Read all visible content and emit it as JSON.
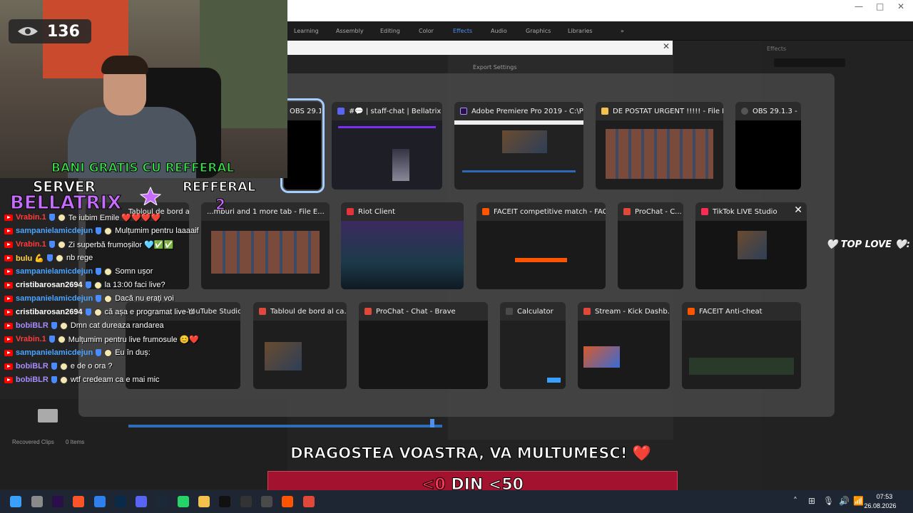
{
  "premiere": {
    "workspace_tabs": [
      "Learning",
      "Assembly",
      "Editing",
      "Color",
      "Effects",
      "Audio",
      "Graphics",
      "Libraries"
    ],
    "overflow": "»",
    "effects_panel": "Effects",
    "export_settings": "Export Settings",
    "recovered_clips": "Recovered Clips",
    "items_count": "0 Items"
  },
  "switcher": {
    "windows": [
      {
        "title": "OBS 29.1.3 -",
        "icon_color": "#555555"
      },
      {
        "title": "#💬 | staff-chat | Bellatrix R...",
        "icon_color": "#5865F2"
      },
      {
        "title": "Adobe Premiere Pro 2019 - C:\\PR...",
        "icon_color": "#9999ff"
      },
      {
        "title": "DE POSTAT URGENT !!!!! - File Ex...",
        "icon_color": "#f2c14e"
      },
      {
        "title": "OBS 29.1.3 -",
        "icon_color": "#555555"
      },
      {
        "title": "Tabloul de bord al...",
        "icon_color": "#e0483a"
      },
      {
        "title": "...mburi and 1 more tab - File E...",
        "icon_color": "#f2c14e"
      },
      {
        "title": "Riot Client",
        "icon_color": "#e2343a"
      },
      {
        "title": "FACEIT competitive match - FACE...",
        "icon_color": "#ff5500"
      },
      {
        "title": "ProChat - C...",
        "icon_color": "#e0483a"
      },
      {
        "title": "TikTok LIVE Studio",
        "icon_color": "#fe2c55"
      },
      {
        "title": "... - YouTube Studio...",
        "icon_color": "#ff0000"
      },
      {
        "title": "Tabloul de bord al ca...",
        "icon_color": "#e0483a"
      },
      {
        "title": "ProChat - Chat - Brave",
        "icon_color": "#e0483a"
      },
      {
        "title": "Calculator",
        "icon_color": "#4a4a4a"
      },
      {
        "title": "Stream - Kick Dashb...",
        "icon_color": "#e0483a"
      },
      {
        "title": "FACEIT Anti-cheat",
        "icon_color": "#ff5500"
      }
    ],
    "close_glyph": "✕"
  },
  "stream": {
    "viewers": "136",
    "promo": {
      "bani": "BANI GRATIS CU REFFERAL",
      "server": "SERVER",
      "bellatrix": "BELLATRIX",
      "refferal": "REFFERAL",
      "two": "2"
    },
    "top_love": "🤍 TOP LOVE 🤍:",
    "banner": "DRAGOSTEA VOASTRA, VA MULTUMESC! ❤️",
    "goal_lead": "<0",
    "goal_rest": " DIN <50"
  },
  "chat": [
    {
      "user": "Vrabin.1",
      "color": "#ff3b3b",
      "msg": "Te iubim Emile ❤️❤️❤️❤️"
    },
    {
      "user": "sampanielamicdejun",
      "color": "#4aa3ff",
      "msg": "Mulțumim pentru laaaaif"
    },
    {
      "user": "Vrabin.1",
      "color": "#ff3b3b",
      "msg": "Zi superbă frumoșilor 🩵✅✅"
    },
    {
      "user": "bulu 💪",
      "color": "#ffd23f",
      "msg": "nb rege"
    },
    {
      "user": "sampanielamicdejun",
      "color": "#4aa3ff",
      "msg": "Somn ușor"
    },
    {
      "user": "cristibarosan2694",
      "color": "#ffffff",
      "msg": "la 13:00 faci live?"
    },
    {
      "user": "sampanielamicdejun",
      "color": "#4aa3ff",
      "msg": "Dacă nu erați voi"
    },
    {
      "user": "cristibarosan2694",
      "color": "#ffffff",
      "msg": "că așa e programat live-ul"
    },
    {
      "user": "bobiBLR",
      "color": "#a78bfa",
      "msg": "Dmn cat dureaza randarea"
    },
    {
      "user": "Vrabin.1",
      "color": "#ff3b3b",
      "msg": "Mulțumim pentru live frumosule 😊❤️"
    },
    {
      "user": "sampanielamicdejun",
      "color": "#4aa3ff",
      "msg": "Eu în duș:"
    },
    {
      "user": "bobiBLR",
      "color": "#a78bfa",
      "msg": "e de o ora ?"
    },
    {
      "user": "bobiBLR",
      "color": "#a78bfa",
      "msg": "wtf credeam ca e mai mic"
    }
  ],
  "taskbar": {
    "time": "07:53",
    "date": "26.08.2026",
    "apps": [
      {
        "name": "start-icon",
        "color": "#3aa0ff"
      },
      {
        "name": "file-manager-icon",
        "color": "#8a8a8a"
      },
      {
        "name": "premiere-icon",
        "color": "#2a0f4a"
      },
      {
        "name": "brave-icon",
        "color": "#fb542b"
      },
      {
        "name": "vscode-icon",
        "color": "#2f80ed"
      },
      {
        "name": "photoshop-icon",
        "color": "#0b2a4a"
      },
      {
        "name": "discord-icon",
        "color": "#5865F2"
      },
      {
        "name": "steam-icon",
        "color": "#1b2838"
      },
      {
        "name": "whatsapp-icon",
        "color": "#25d366"
      },
      {
        "name": "folder-icon",
        "color": "#f2c14e"
      },
      {
        "name": "tiktok-icon",
        "color": "#111111"
      },
      {
        "name": "obs-icon",
        "color": "#333333"
      },
      {
        "name": "calculator-icon",
        "color": "#4a4a4a"
      },
      {
        "name": "faceit-icon",
        "color": "#ff5500"
      },
      {
        "name": "prochat-icon",
        "color": "#e0483a"
      }
    ],
    "tray": [
      "˄",
      "⊞",
      "🎙",
      "🔊",
      "📶",
      "🌐"
    ]
  }
}
